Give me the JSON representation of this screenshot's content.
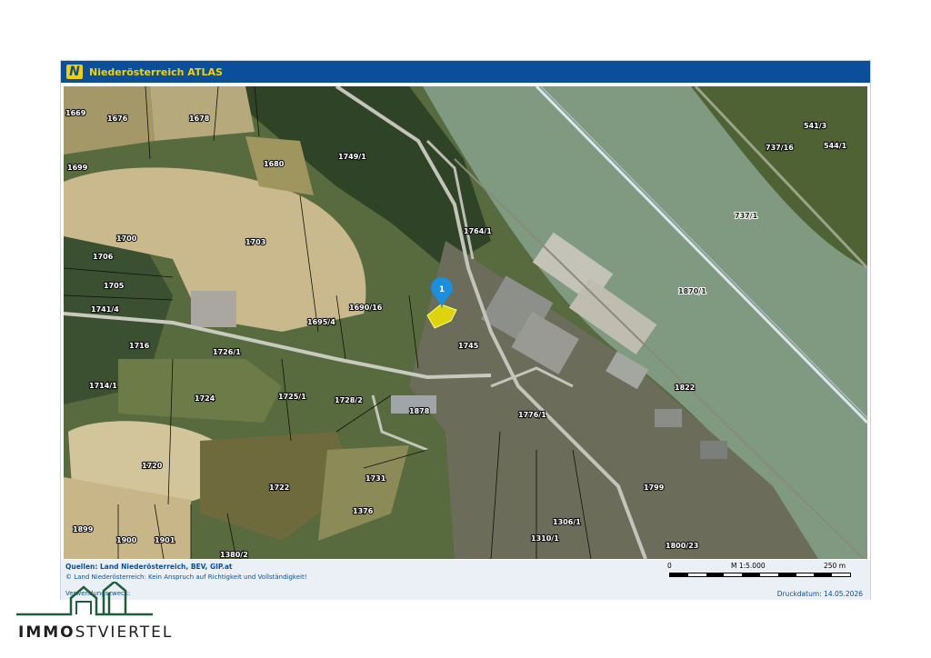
{
  "window": {
    "title": "Niederösterreich ATLAS",
    "logo_letter": "N"
  },
  "map": {
    "marker": {
      "label": "1",
      "color": "#1a8fe0"
    },
    "highlight_color": "#f2e600",
    "river_color": "#7f9a80",
    "parcels": [
      "1669",
      "1676",
      "1678",
      "1680",
      "1699",
      "1749/1",
      "541/3",
      "737/16",
      "544/1",
      "1700",
      "1703",
      "1706",
      "1705",
      "1741/4",
      "1690/16",
      "1695/4",
      "1764/1",
      "737/1",
      "1870/1",
      "1716",
      "1726/1",
      "1745",
      "1714/1",
      "1724",
      "1725/1",
      "1728/2",
      "1878",
      "1822",
      "1776/1",
      "1720",
      "1722",
      "1731",
      "1799",
      "1376",
      "1306/1",
      "1899",
      "1900",
      "1901",
      "1310/1",
      "1800/23",
      "1380/2"
    ]
  },
  "footer": {
    "sources": "Quellen: Land Niederösterreich, BEV, GIP.at",
    "copyright": "© Land Niederösterreich: Kein Anspruch auf Richtigkeit und Vollständigkeit!",
    "purpose": "Verwendungszweck:",
    "print_date": "Druckdatum: 14.05.2026",
    "scale": {
      "start": "0",
      "ratio": "M 1:5.000",
      "end": "250 m"
    }
  },
  "brand": {
    "bold": "IMMO",
    "rest": "STVIERTEL",
    "color": "#1e5e3a"
  }
}
